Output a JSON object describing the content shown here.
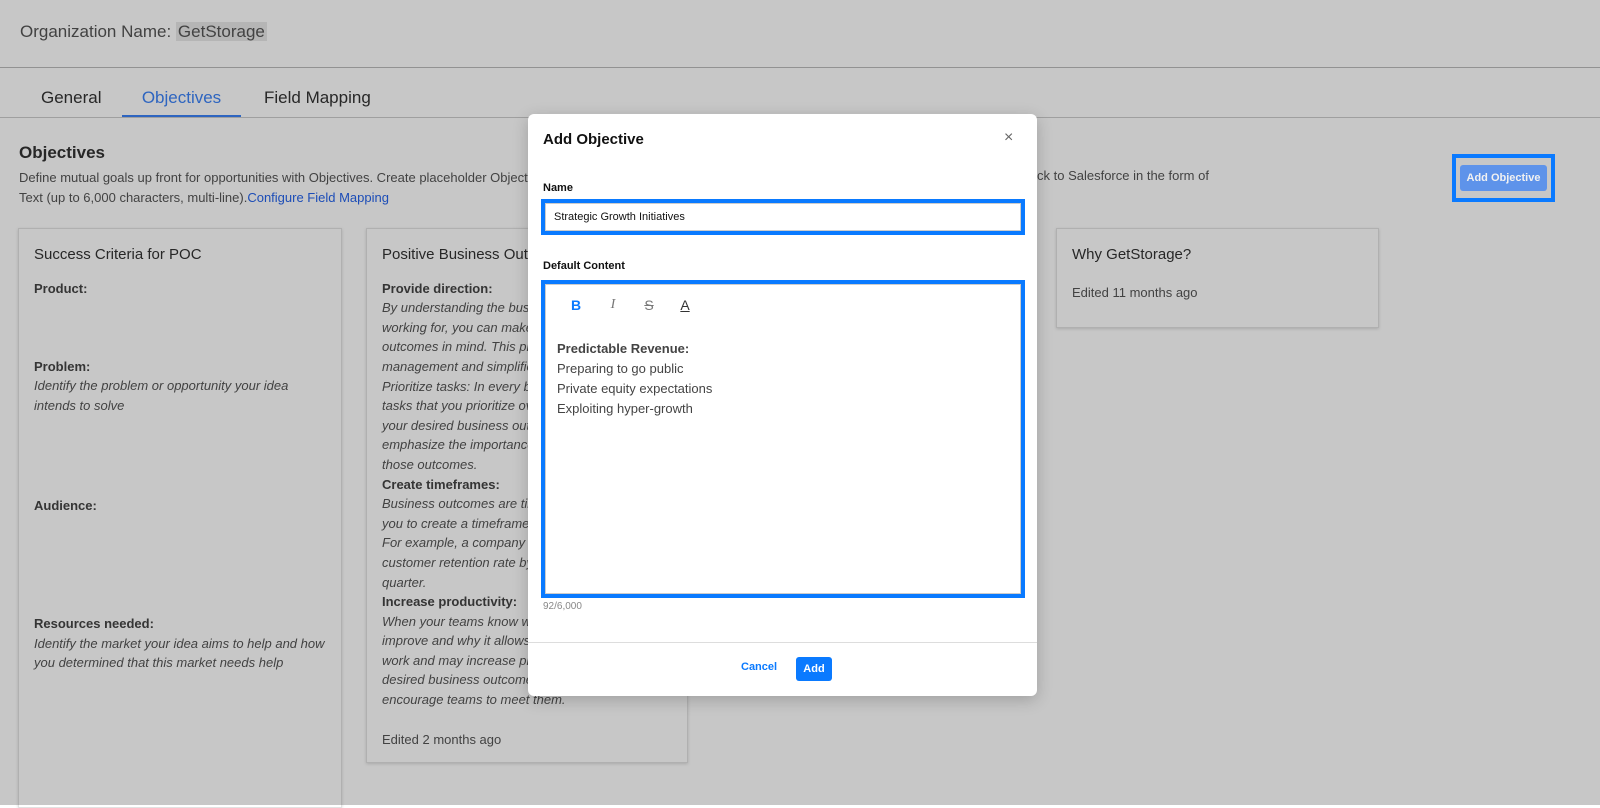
{
  "header": {
    "org_label": "Organization Name:",
    "org_value": "GetStorage"
  },
  "tabs": [
    {
      "label": "General"
    },
    {
      "label": "Objectives",
      "active": true
    },
    {
      "label": "Field Mapping"
    }
  ],
  "section": {
    "title": "Objectives",
    "desc_left": "Define mutual goals up front for opportunities with Objectives. Create placeholder Objectiv",
    "desc_right": "ck to Salesforce in the form of",
    "desc_line2": "Text (up to 6,000 characters, multi-line).",
    "link": "Configure Field Mapping",
    "add_button": "Add Objective"
  },
  "cards": [
    {
      "title": "Success Criteria for POC",
      "items": [
        {
          "h": "Product:",
          "t": ""
        },
        {
          "h": "Problem:",
          "t": "Identify the problem or opportunity your idea intends to solve"
        },
        {
          "h": "Audience:",
          "t": ""
        },
        {
          "h": "Resources needed:",
          "t": "Identify the market your idea aims to help and how you determined that this market needs help"
        }
      ]
    },
    {
      "title": "Positive Business Outc",
      "lines": [
        [
          "b",
          "Provide direction:"
        ],
        [
          "i",
          "By understanding the busi"
        ],
        [
          "i",
          "working for, you can make"
        ],
        [
          "i",
          "outcomes in mind. This pr"
        ],
        [
          "i",
          "management and simplifie"
        ],
        [
          "i",
          "Prioritize tasks: In every bu"
        ],
        [
          "i",
          "tasks that you prioritize ov"
        ],
        [
          "i",
          "your desired business outc"
        ],
        [
          "i",
          "emphasize the importance"
        ],
        [
          "i",
          "those outcomes."
        ],
        [
          "b",
          "Create timeframes:"
        ],
        [
          "i",
          "Business outcomes are tin"
        ],
        [
          "i",
          "you to create a timeframe"
        ],
        [
          "i",
          "For example, a company m"
        ],
        [
          "i",
          "customer retention rate by"
        ],
        [
          "i",
          "quarter."
        ],
        [
          "b",
          "Increase productivity:"
        ],
        [
          "i",
          "When your teams know wh"
        ],
        [
          "i",
          "improve and why it allows"
        ],
        [
          "i",
          "work and may increase pro"
        ],
        [
          "i",
          "desired business outcome"
        ],
        [
          "i",
          "encourage teams to meet them."
        ]
      ],
      "edited": "Edited 2 months ago"
    },
    {
      "title": "Why GetStorage?",
      "edited": "Edited 11 months ago"
    }
  ],
  "modal": {
    "title": "Add Objective",
    "close": "×",
    "name_label": "Name",
    "name_value": "Strategic Growth Initiatives",
    "content_label": "Default Content",
    "toolbar": {
      "bold": "B",
      "italic": "I",
      "strike": "S",
      "color": "A"
    },
    "content_heading": "Predictable Revenue:",
    "content_lines": [
      "Preparing to go public",
      "Private equity expectations",
      "Exploiting hyper-growth"
    ],
    "counter": "92/6,000",
    "cancel": "Cancel",
    "add": "Add"
  },
  "colors": {
    "accent": "#0a7aff",
    "link": "#2563eb",
    "highlight": "#0a7aff"
  }
}
